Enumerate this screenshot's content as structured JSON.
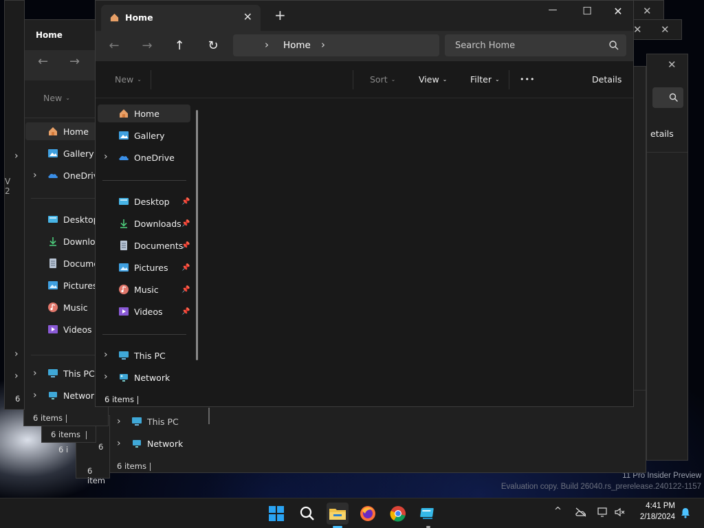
{
  "main_window": {
    "tab_title": "Home",
    "tab_close": "✕",
    "new_tab": "+",
    "controls": {
      "minimize": "—",
      "maximize": "☐",
      "close": "✕"
    },
    "nav": {
      "back": "←",
      "forward": "→",
      "up": "↑",
      "refresh": "↻"
    },
    "address": {
      "separator": "›",
      "crumb": "Home"
    },
    "search_placeholder": "Search Home",
    "toolbar": {
      "new_label": "New",
      "sort_label": "Sort",
      "view_label": "View",
      "filter_label": "Filter",
      "more_label": "•••",
      "details_label": "Details",
      "caret": "⌄"
    },
    "sidebar": {
      "top_items": [
        {
          "label": "Home",
          "icon": "home-icon",
          "selected": true
        },
        {
          "label": "Gallery",
          "icon": "gallery-icon"
        },
        {
          "label": "OneDrive",
          "icon": "onedrive-icon",
          "expandable": true
        }
      ],
      "pinned_items": [
        {
          "label": "Desktop",
          "icon": "desktop-icon"
        },
        {
          "label": "Downloads",
          "icon": "downloads-icon"
        },
        {
          "label": "Documents",
          "icon": "documents-icon"
        },
        {
          "label": "Pictures",
          "icon": "pictures-icon"
        },
        {
          "label": "Music",
          "icon": "music-icon"
        },
        {
          "label": "Videos",
          "icon": "videos-icon"
        }
      ],
      "bottom_items": [
        {
          "label": "This PC",
          "icon": "this-pc-icon"
        },
        {
          "label": "Network",
          "icon": "network-icon"
        }
      ],
      "pin_glyph": "📌",
      "chevron": "›"
    },
    "status": "6 items"
  },
  "ghost_windows": {
    "title": "Home",
    "labels": {
      "new": "New",
      "home": "Home",
      "gallery": "Gallery",
      "onedrive": "OneDrive",
      "desktop": "Desktop",
      "downloads": "Downloa",
      "documents": "Documer",
      "pictures": "Pictures",
      "music": "Music",
      "videos": "Videos",
      "this_pc": "This PC",
      "network": "Network",
      "details_partial": "etails",
      "status": "6 items",
      "status_short": "6 item",
      "status_tiny": "6 i",
      "status_six": "6",
      "partial_v": "V",
      "partial_2": "2"
    }
  },
  "desktop": {
    "watermark_line1": "11 Pro Insider Preview",
    "watermark_line2": "Evaluation copy. Build 26040.rs_prerelease.240122-1157"
  },
  "taskbar": {
    "apps": [
      {
        "name": "start",
        "icon": "windows-start-icon"
      },
      {
        "name": "search",
        "icon": "search-icon"
      },
      {
        "name": "file-explorer",
        "icon": "file-explorer-icon",
        "active": true
      },
      {
        "name": "firefox",
        "icon": "firefox-icon"
      },
      {
        "name": "chrome",
        "icon": "chrome-icon"
      },
      {
        "name": "app",
        "icon": "app-icon"
      }
    ],
    "time": "4:41 PM",
    "date": "2/18/2024",
    "tray_chevron": "^"
  },
  "colors": {
    "accent": "#4cc2ff",
    "window_bg": "#191919",
    "titlebar_bg": "#202020",
    "toolbar_bg": "#2b2b2b",
    "folder_yellow": "#f0c24b"
  }
}
